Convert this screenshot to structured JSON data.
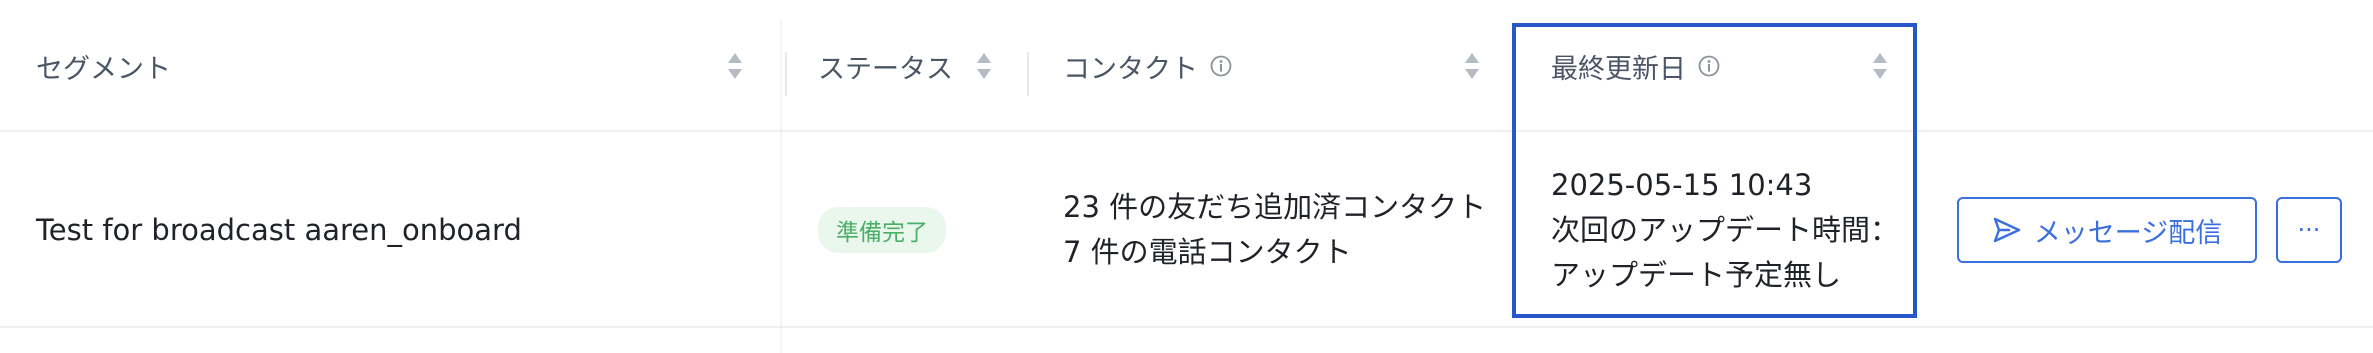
{
  "table": {
    "headers": {
      "segment": "セグメント",
      "status": "ステータス",
      "contact": "コンタクト",
      "last_updated": "最終更新日"
    },
    "rows": [
      {
        "segment": "Test for broadcast aaren_onboard",
        "status": "準備完了",
        "contact_line1": "23 件の友だち追加済コンタクト",
        "contact_line2": "7 件の電話コンタクト",
        "updated_line1": "2025-05-15 10:43",
        "updated_line2": "次回のアップデート時間：",
        "updated_line3": "アップデート予定無し",
        "action_label": "メッセージ配信",
        "more_label": "···"
      }
    ]
  },
  "icons": {
    "info": "info-icon",
    "sort": "sort-icon",
    "send": "send-icon"
  },
  "colors": {
    "accent": "#3a6fe0",
    "highlight": "#2657c8",
    "status_bg": "#e9f7ec",
    "status_text": "#4caf68"
  }
}
